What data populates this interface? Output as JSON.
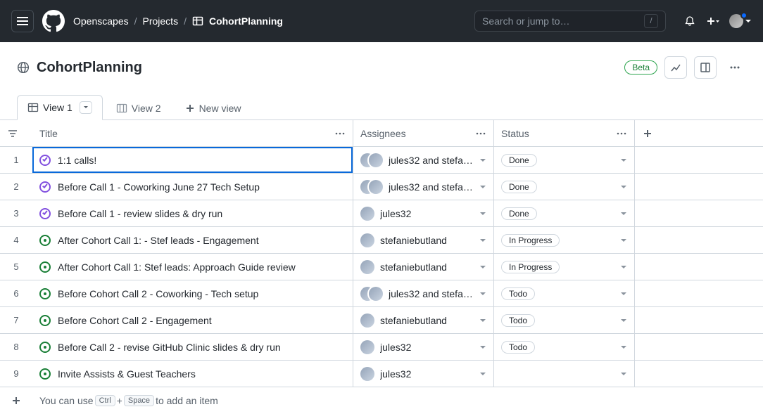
{
  "topbar": {
    "org": "Openscapes",
    "section": "Projects",
    "project": "CohortPlanning",
    "search_placeholder": "Search or jump to…",
    "slash": "/"
  },
  "subhead": {
    "title": "CohortPlanning",
    "beta": "Beta"
  },
  "tabs": {
    "view1": "View 1",
    "view2": "View 2",
    "newview": "New view"
  },
  "columns": {
    "title": "Title",
    "assignees": "Assignees",
    "status": "Status"
  },
  "rows": [
    {
      "n": "1",
      "state": "done",
      "title": "1:1 calls!",
      "assignees": "jules32 and stefani…",
      "avatars": 2,
      "status": "Done",
      "active": true
    },
    {
      "n": "2",
      "state": "done",
      "title": "Before Call 1 - Coworking June 27 Tech Setup",
      "assignees": "jules32 and stefani…",
      "avatars": 2,
      "status": "Done"
    },
    {
      "n": "3",
      "state": "done",
      "title": "Before Call 1 - review slides & dry run",
      "assignees": "jules32",
      "avatars": 1,
      "status": "Done"
    },
    {
      "n": "4",
      "state": "open",
      "title": "After Cohort Call 1: - Stef leads - Engagement",
      "assignees": "stefaniebutland",
      "avatars": 1,
      "status": "In Progress"
    },
    {
      "n": "5",
      "state": "open",
      "title": "After Cohort Call 1: Stef leads: Approach Guide review",
      "assignees": "stefaniebutland",
      "avatars": 1,
      "status": "In Progress"
    },
    {
      "n": "6",
      "state": "open",
      "title": "Before Cohort Call 2 - Coworking - Tech setup",
      "assignees": "jules32 and stefani…",
      "avatars": 2,
      "status": "Todo"
    },
    {
      "n": "7",
      "state": "open",
      "title": "Before Cohort Call 2 - Engagement",
      "assignees": "stefaniebutland",
      "avatars": 1,
      "status": "Todo"
    },
    {
      "n": "8",
      "state": "open",
      "title": "Before Call 2 - revise GitHub Clinic slides & dry run",
      "assignees": "jules32",
      "avatars": 1,
      "status": "Todo"
    },
    {
      "n": "9",
      "state": "open",
      "title": "Invite Assists & Guest Teachers",
      "assignees": "jules32",
      "avatars": 1,
      "status": ""
    }
  ],
  "footer": {
    "pre": "You can use ",
    "k1": "Ctrl",
    "plus": "+",
    "k2": "Space",
    "post": " to add an item"
  }
}
